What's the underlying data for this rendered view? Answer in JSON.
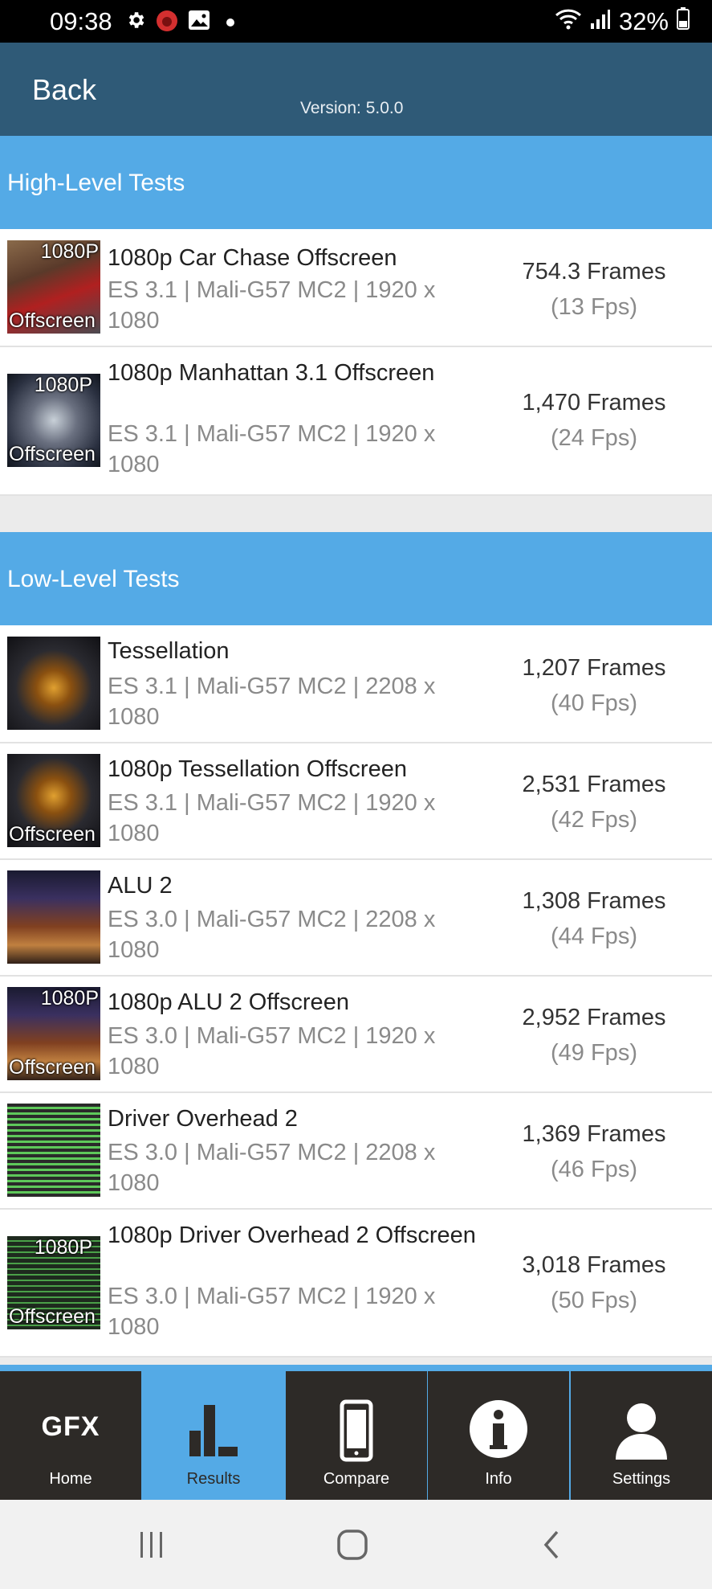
{
  "status": {
    "time": "09:38",
    "battery": "32%"
  },
  "header": {
    "back_label": "Back",
    "version": "Version: 5.0.0"
  },
  "sections": [
    {
      "title": "High-Level Tests",
      "items": [
        {
          "title": "1080p Car Chase Offscreen",
          "subtitle": "ES 3.1 | Mali-G57 MC2 | 1920 x 1080",
          "frames": "754.3 Frames",
          "fps": "(13 Fps)",
          "thumb_top": "1080P",
          "thumb_bottom": "Offscreen"
        },
        {
          "title": "1080p Manhattan 3.1 Offscreen",
          "subtitle": "ES 3.1 | Mali-G57 MC2 | 1920 x 1080",
          "frames": "1,470 Frames",
          "fps": "(24 Fps)",
          "thumb_top": "1080P",
          "thumb_bottom": "Offscreen"
        }
      ]
    },
    {
      "title": "Low-Level Tests",
      "items": [
        {
          "title": "Tessellation",
          "subtitle": "ES 3.1 | Mali-G57 MC2 | 2208 x 1080",
          "frames": "1,207 Frames",
          "fps": "(40 Fps)"
        },
        {
          "title": "1080p Tessellation Offscreen",
          "subtitle": "ES 3.1 | Mali-G57 MC2 | 1920 x 1080",
          "frames": "2,531 Frames",
          "fps": "(42 Fps)",
          "thumb_bottom": "Offscreen"
        },
        {
          "title": "ALU 2",
          "subtitle": "ES 3.0 | Mali-G57 MC2 | 2208 x 1080",
          "frames": "1,308 Frames",
          "fps": "(44 Fps)"
        },
        {
          "title": "1080p ALU 2 Offscreen",
          "subtitle": "ES 3.0 | Mali-G57 MC2 | 1920 x 1080",
          "frames": "2,952 Frames",
          "fps": "(49 Fps)",
          "thumb_top": "1080P",
          "thumb_bottom": "Offscreen"
        },
        {
          "title": "Driver Overhead 2",
          "subtitle": "ES 3.0 | Mali-G57 MC2 | 2208 x 1080",
          "frames": "1,369 Frames",
          "fps": "(46 Fps)"
        },
        {
          "title": "1080p Driver Overhead 2 Offscreen",
          "subtitle": "ES 3.0 | Mali-G57 MC2 | 1920 x 1080",
          "frames": "3,018 Frames",
          "fps": "(50 Fps)",
          "thumb_top": "1080P",
          "thumb_bottom": "Offscreen"
        }
      ]
    }
  ],
  "tabs": [
    {
      "label": "Home",
      "icon": "gfx-logo-icon",
      "logo_text": "GFX",
      "active": false
    },
    {
      "label": "Results",
      "icon": "bar-chart-icon",
      "active": true
    },
    {
      "label": "Compare",
      "icon": "phone-icon",
      "active": false
    },
    {
      "label": "Info",
      "icon": "info-icon",
      "active": false
    },
    {
      "label": "Settings",
      "icon": "user-icon",
      "active": false
    }
  ],
  "colors": {
    "section_header": "#54aae6",
    "app_bar": "#2f5a77",
    "tab_bar": "#2d2a27"
  }
}
